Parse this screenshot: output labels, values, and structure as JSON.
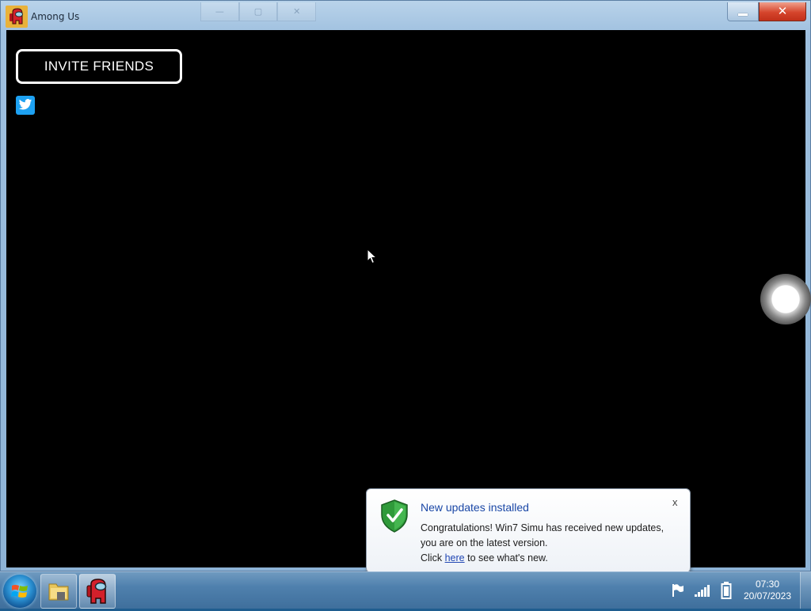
{
  "window": {
    "title": "Among Us",
    "close_glyph": "✕",
    "ghost_close_glyph": "✕"
  },
  "game": {
    "invite_label": "INVITE FRIENDS",
    "share_icon": "twitter-icon",
    "joystick": "virtual-joystick"
  },
  "notification": {
    "title": "New updates installed",
    "message": "Congratulations! Win7 Simu has received new updates, you are on the latest version.",
    "click_prefix": "Click",
    "link_text": "here",
    "click_suffix": "to see what's new.",
    "close_glyph": "x"
  },
  "taskbar": {
    "items": [
      "start-button",
      "file-explorer",
      "among-us"
    ],
    "tray_icons": [
      "action-center-flag-icon",
      "signal-icon",
      "battery-icon"
    ],
    "time": "07:30",
    "date": "20/07/2023"
  },
  "colors": {
    "accent_title": "#1a47a6",
    "game_background": "#000000",
    "twitter_blue": "#1da1f2",
    "close_red": "#d5452c"
  }
}
